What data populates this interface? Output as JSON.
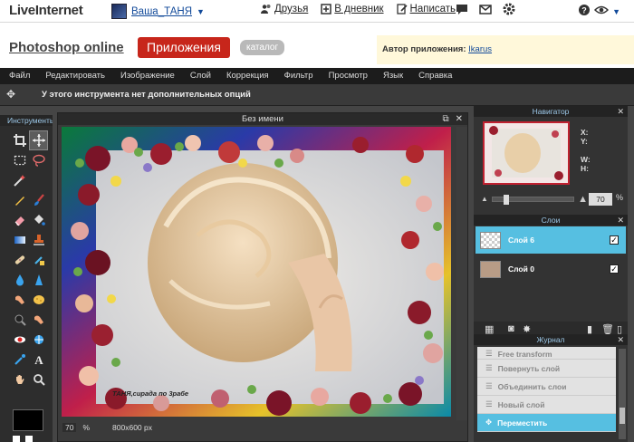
{
  "site": {
    "logo": "LiveInternet",
    "user_name": "Ваша_ТАНЯ",
    "links": [
      "Друзья",
      "В дневник",
      "Написать"
    ]
  },
  "app_header": {
    "title": "Photoshop online",
    "apps_button": "Приложения",
    "catalog_button": "каталог",
    "author_label": "Автор приложения:",
    "author_name": "Ikarus"
  },
  "menu": [
    "Файл",
    "Редактировать",
    "Изображение",
    "Слой",
    "Коррекция",
    "Фильтр",
    "Просмотр",
    "Язык",
    "Справка"
  ],
  "options_hint": "У этого инструмента нет дополнительных опций",
  "toolbox": {
    "title": "Инструменты",
    "tools": [
      "crop-icon",
      "move-icon",
      "marquee-icon",
      "lasso-icon",
      "magic-wand-icon",
      "blank",
      "pencil-icon",
      "brush-icon",
      "eraser-icon",
      "bucket-icon",
      "gradient-icon",
      "stamp-icon",
      "heal-icon",
      "replace-color-icon",
      "blur-icon",
      "sharpen-icon",
      "smudge-icon",
      "sponge-icon",
      "burn-icon",
      "dodge-icon",
      "redeye-icon",
      "bloat-icon",
      "picker-icon",
      "text-icon",
      "hand-icon",
      "zoom-icon"
    ],
    "foreground_color": "#000000",
    "background_color": "#ffffff"
  },
  "document": {
    "title": "Без имени",
    "zoom": "70",
    "zoom_unit": "%",
    "size": "800x600 px",
    "signature": "ТАНЯ,сирада по 3рабе"
  },
  "navigator": {
    "title": "Навигатор",
    "x_label": "X:",
    "y_label": "Y:",
    "w_label": "W:",
    "h_label": "H:",
    "zoom": "70",
    "zoom_unit": "%"
  },
  "layers": {
    "title": "Слои",
    "items": [
      {
        "name": "Слой 6",
        "visible": true,
        "selected": true
      },
      {
        "name": "Слой 0",
        "visible": true,
        "selected": false
      }
    ]
  },
  "history": {
    "title": "Журнал",
    "items": [
      {
        "label": "Free transform",
        "selected": false
      },
      {
        "label": "Повернуть слой",
        "selected": false
      },
      {
        "label": "Объединить слои",
        "selected": false
      },
      {
        "label": "Новый слой",
        "selected": false
      },
      {
        "label": "Переместить",
        "selected": true
      }
    ]
  },
  "colors": {
    "accent_red": "#c7261b",
    "selection_blue": "#56bfe1",
    "panel_title_blue": "#9cc8e8"
  }
}
